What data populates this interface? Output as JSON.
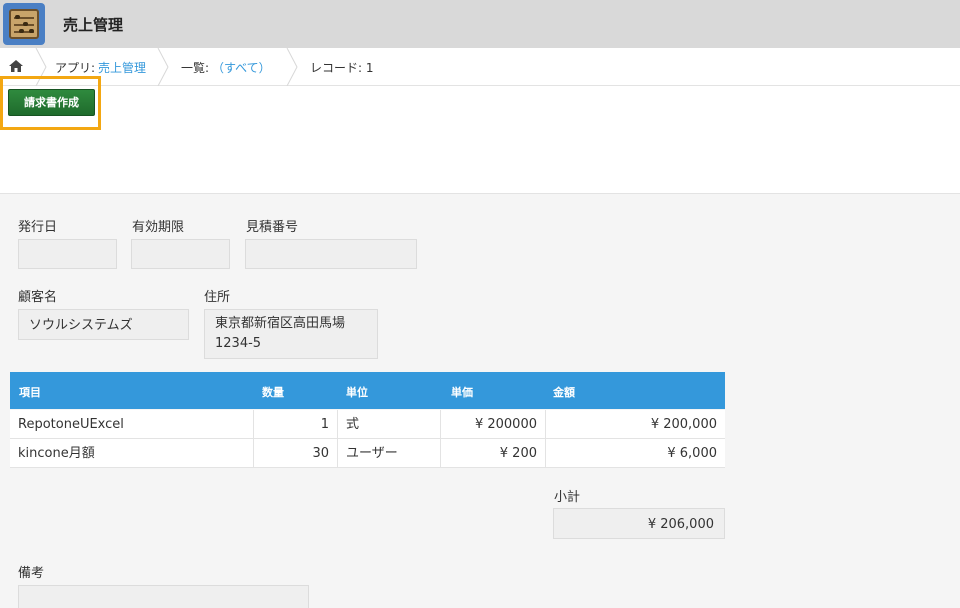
{
  "app": {
    "title": "売上管理",
    "icon": "abacus-icon"
  },
  "breadcrumb": {
    "app_prefix": "アプリ:",
    "app_link": "売上管理",
    "list_prefix": "一覧:",
    "list_link": "（すべて）",
    "record": "レコード: 1"
  },
  "toolbar": {
    "invoice_button": "請求書作成",
    "highlight_color": "#f3a712"
  },
  "fields": {
    "issue_date_label": "発行日",
    "expiry_label": "有効期限",
    "quote_no_label": "見積番号",
    "issue_date_value": "",
    "expiry_value": "",
    "quote_no_value": "",
    "customer_label": "顧客名",
    "customer_value": "ソウルシステムズ",
    "address_label": "住所",
    "address_value": "東京都新宿区高田馬場\n1234-5",
    "subtotal_label": "小計",
    "subtotal_value": "¥ 206,000",
    "notes_label": "備考",
    "notes_value": ""
  },
  "table": {
    "headers": [
      "項目",
      "数量",
      "単位",
      "単価",
      "金額"
    ],
    "rows": [
      [
        "RepotoneUExcel",
        "1",
        "式",
        "¥ 200000",
        "¥ 200,000"
      ],
      [
        "kincone月額",
        "30",
        "ユーザー",
        "¥ 200",
        "¥ 6,000"
      ]
    ]
  },
  "colors": {
    "header_blue": "#3498db",
    "button_green": "#1f6b2c",
    "link": "#3498db"
  }
}
